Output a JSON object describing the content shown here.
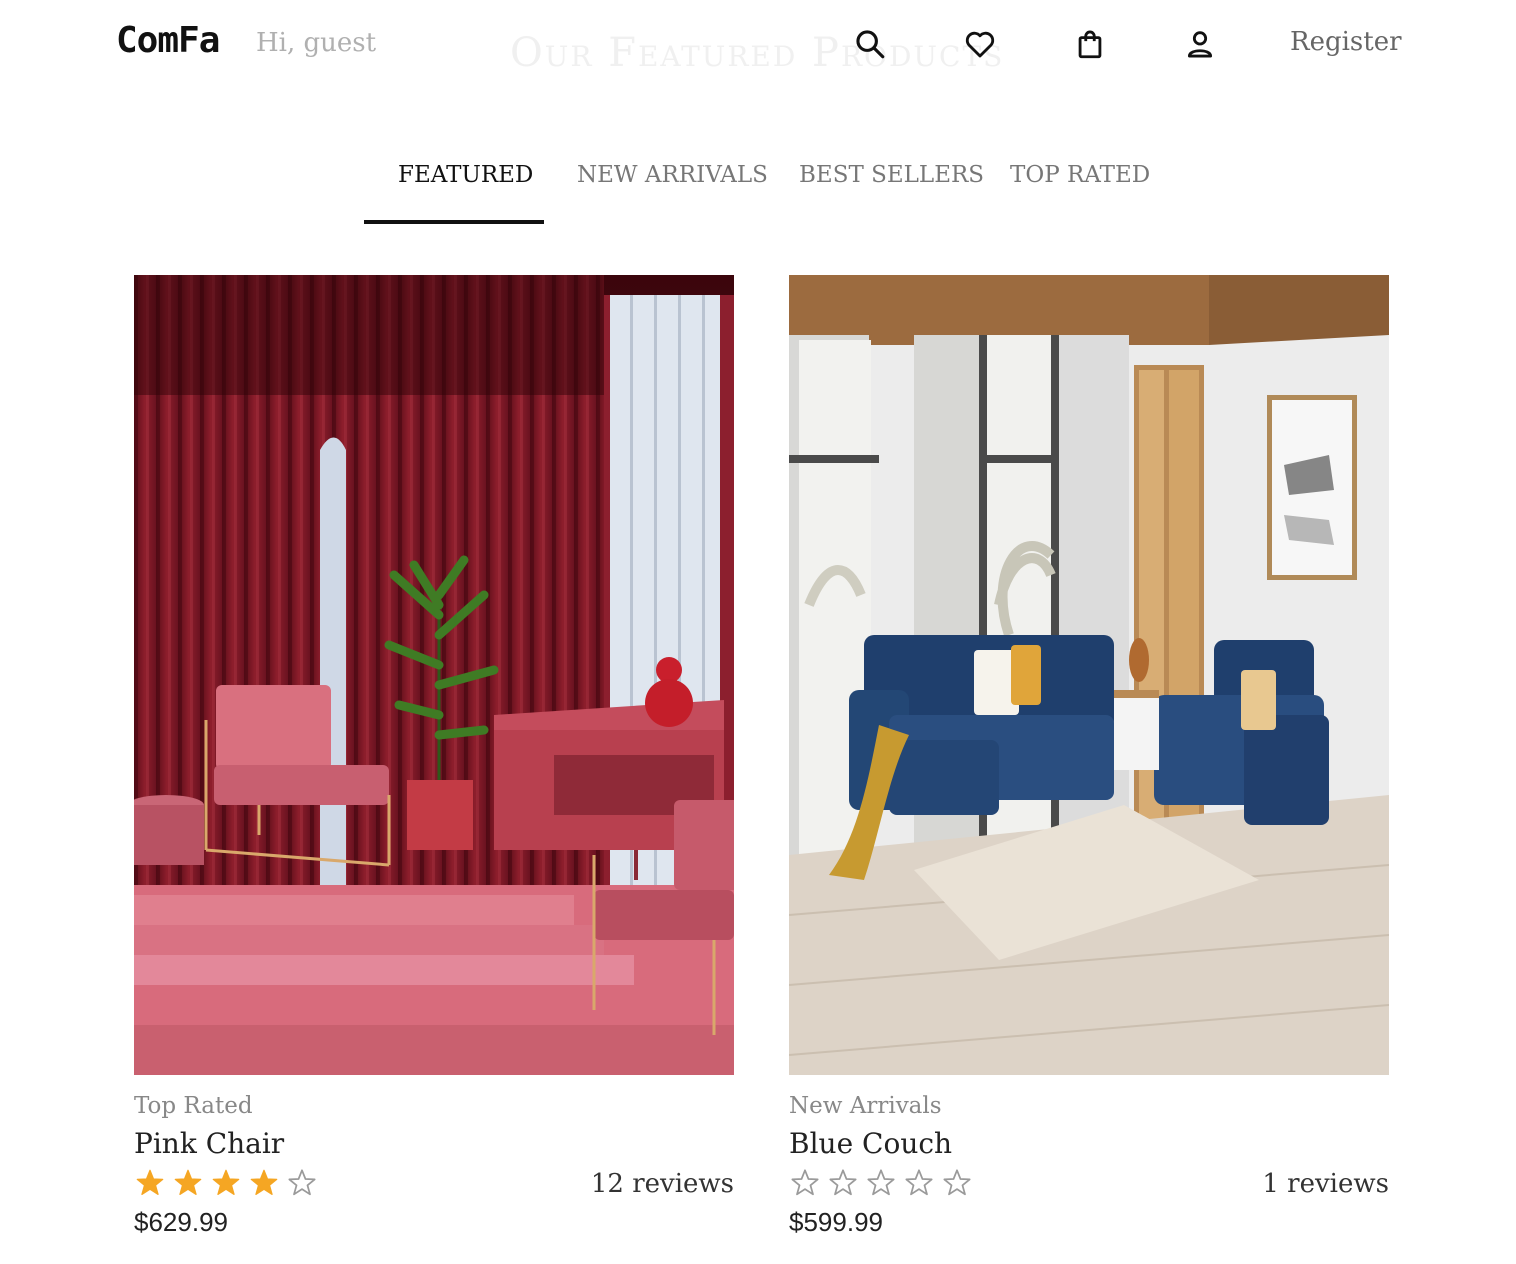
{
  "header": {
    "logo": "ComFa",
    "greeting": "Hi, guest",
    "ghost_title": "Our Featured Products",
    "register_label": "Register"
  },
  "tabs": [
    {
      "label": "FEATURED",
      "active": true
    },
    {
      "label": "NEW ARRIVALS",
      "active": false
    },
    {
      "label": "BEST SELLERS",
      "active": false
    },
    {
      "label": "TOP RATED",
      "active": false
    }
  ],
  "products": [
    {
      "category": "Top Rated",
      "name": "Pink Chair",
      "rating": 4,
      "max_rating": 5,
      "reviews": "12 reviews",
      "price": "$629.99"
    },
    {
      "category": "New Arrivals",
      "name": "Blue Couch",
      "rating": 0,
      "max_rating": 5,
      "reviews": "1 reviews",
      "price": "$599.99"
    }
  ],
  "colors": {
    "star_filled": "#f5a623",
    "star_empty": "#9a9a9a",
    "accent": "#111111"
  }
}
